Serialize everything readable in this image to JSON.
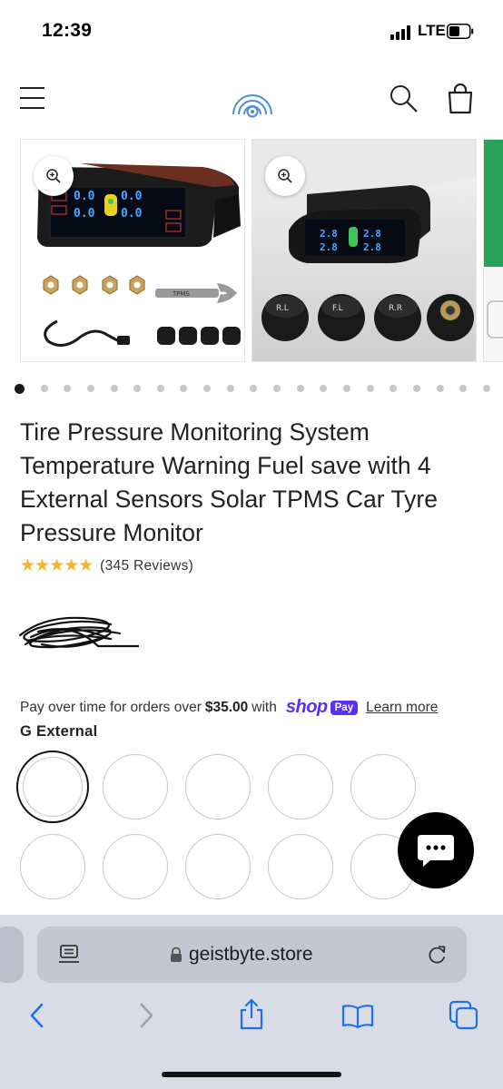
{
  "status_bar": {
    "time": "12:39",
    "network": "LTE"
  },
  "header": {
    "menu_icon": "hamburger-menu-icon",
    "logo_icon": "rainbow-circle-logo",
    "search_icon": "search-icon",
    "cart_icon": "shopping-bag-icon"
  },
  "gallery": {
    "image_count": 21,
    "active_index": 0,
    "zoom_icon": "zoom-in-icon",
    "device_readouts": [
      "0.0",
      "0.0",
      "0.0",
      "0.0",
      "2.8",
      "2.8",
      "2.8",
      "2.8"
    ],
    "sensor_labels": [
      "R.L",
      "F.L",
      "R.R"
    ],
    "wrench_label": "TPMS"
  },
  "product": {
    "title": "Tire Pressure Monitoring System Temperature Warning Fuel save with 4 External Sensors Solar TPMS Car Tyre Pressure Monitor",
    "rating": 5,
    "stars": "★★★★★",
    "reviews": "(345 Reviews)"
  },
  "shop_pay": {
    "prefix": "Pay over time for orders over",
    "amount": "$35.00",
    "suffix": "with",
    "brand": "shop",
    "badge": "Pay",
    "learn_more": "Learn more"
  },
  "variant": {
    "label": "G External",
    "selected_index": 0,
    "swatch_count_visible": 10
  },
  "chat": {
    "icon": "chat-bubble-icon"
  },
  "browser": {
    "url": "geistbyte.store",
    "reader_icon": "reader-mode-icon",
    "lock_icon": "lock-icon",
    "reload_icon": "reload-icon",
    "toolbar_icons": [
      "back-icon",
      "forward-icon",
      "share-icon",
      "bookmarks-icon",
      "tabs-icon"
    ]
  },
  "colors": {
    "accent_shop_pay": "#5a31f4",
    "star": "#f5b52e",
    "browser_chrome": "#d9dbe6",
    "toolbar_icon": "#1a73e8"
  }
}
